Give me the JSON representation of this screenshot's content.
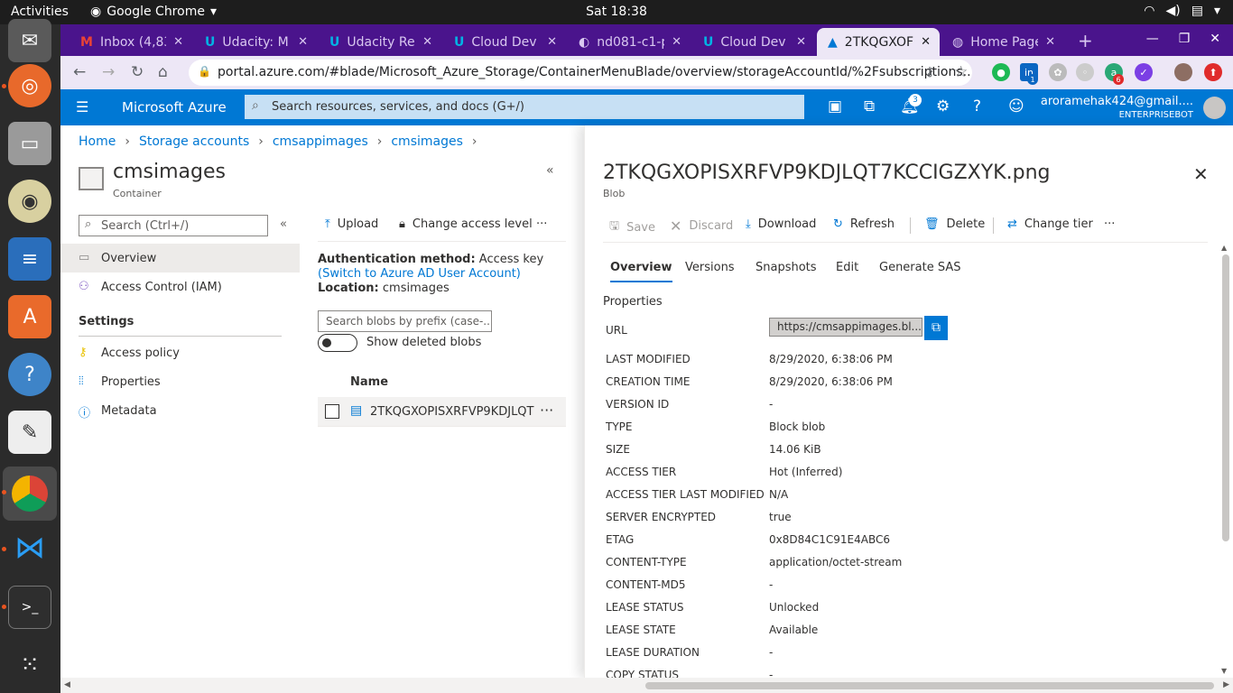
{
  "os": {
    "activities": "Activities",
    "app_name": "Google Chrome",
    "clock": "Sat 18:38"
  },
  "tabs": [
    {
      "label": "Inbox (4,83",
      "icon": "gmail-icon"
    },
    {
      "label": "Udacity: M",
      "icon": "udacity-icon"
    },
    {
      "label": "Udacity Re",
      "icon": "udacity-icon"
    },
    {
      "label": "Cloud Dev",
      "icon": "udacity-icon"
    },
    {
      "label": "nd081-c1-p",
      "icon": "github-icon"
    },
    {
      "label": "Cloud Dev",
      "icon": "udacity-icon"
    },
    {
      "label": "2TKQGXOF",
      "icon": "azure-icon"
    },
    {
      "label": "Home Page",
      "icon": "globe-icon"
    }
  ],
  "address": {
    "url": "portal.azure.com/#blade/Microsoft_Azure_Storage/ContainerMenuBlade/overview/storageAccountId/%2Fsubscriptions..."
  },
  "extensions": {
    "linkedin_badge": "1",
    "ext_badge": "6"
  },
  "azure": {
    "brand": "Microsoft Azure",
    "search_placeholder": "Search resources, services, and docs (G+/)",
    "notifications_count": "3",
    "user_email": "arorameh​ak424@gmail....",
    "user_directory": "ENTERPRISEBOT"
  },
  "breadcrumb": [
    "Home",
    "Storage accounts",
    "cmsappimages",
    "cmsimages"
  ],
  "container": {
    "title": "cmsimages",
    "subtitle": "Container",
    "search_placeholder": "Search (Ctrl+/)",
    "menu": {
      "overview": "Overview",
      "iam": "Access Control (IAM)",
      "settings_header": "Settings",
      "access_policy": "Access policy",
      "properties": "Properties",
      "metadata": "Metadata"
    }
  },
  "middle": {
    "upload": "Upload",
    "change_access": "Change access level",
    "more": "···",
    "auth_label": "Authentication method:",
    "auth_value": "Access key",
    "auth_link": "(Switch to Azure AD User Account)",
    "location_label": "Location:",
    "location_value": "cmsimages",
    "blob_search_placeholder": "Search blobs by prefix (case-...",
    "show_deleted": "Show deleted blobs",
    "name_header": "Name",
    "blob_name": "2TKQGXOPISXRFVP9KDJLQT7...",
    "row_more": "···"
  },
  "blob": {
    "title": "2TKQGXOPISXRFVP9KDJLQT7KCCIGZXYK.png",
    "subtitle": "Blob",
    "toolbar": {
      "save": "Save",
      "discard": "Discard",
      "download": "Download",
      "refresh": "Refresh",
      "delete": "Delete",
      "change_tier": "Change tier",
      "more": "···"
    },
    "tabs": [
      "Overview",
      "Versions",
      "Snapshots",
      "Edit",
      "Generate SAS"
    ],
    "properties_header": "Properties",
    "url_label": "URL",
    "url_value": "https://cmsappimages.bl...",
    "rows": [
      {
        "key": "LAST MODIFIED",
        "value": "8/29/2020, 6:38:06 PM"
      },
      {
        "key": "CREATION TIME",
        "value": "8/29/2020, 6:38:06 PM"
      },
      {
        "key": "VERSION ID",
        "value": "-"
      },
      {
        "key": "TYPE",
        "value": "Block blob"
      },
      {
        "key": "SIZE",
        "value": "14.06 KiB"
      },
      {
        "key": "ACCESS TIER",
        "value": "Hot (Inferred)"
      },
      {
        "key": "ACCESS TIER LAST MODIFIED",
        "value": "N/A"
      },
      {
        "key": "SERVER ENCRYPTED",
        "value": "true"
      },
      {
        "key": "ETAG",
        "value": "0x8D84C1C91E4ABC6"
      },
      {
        "key": "CONTENT-TYPE",
        "value": "application/octet-stream"
      },
      {
        "key": "CONTENT-MD5",
        "value": "-"
      },
      {
        "key": "LEASE STATUS",
        "value": "Unlocked"
      },
      {
        "key": "LEASE STATE",
        "value": "Available"
      },
      {
        "key": "LEASE DURATION",
        "value": "-"
      },
      {
        "key": "COPY STATUS",
        "value": "-"
      }
    ]
  },
  "colors": {
    "azure_blue": "#0078d4",
    "chrome_purple": "#4a148c",
    "tab_active": "#ede7f6"
  }
}
